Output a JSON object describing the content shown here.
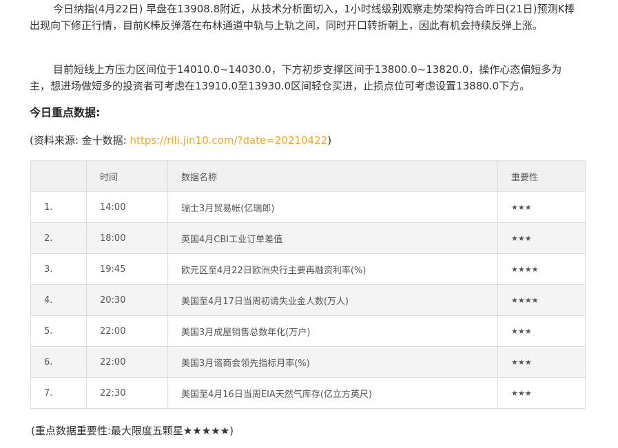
{
  "article": {
    "paragraph1": "今日纳指(4月22日) 早盘在13908.8附近，从技术分析面切入，1小时线级别观察走势架构符合昨日(21日)预测K棒出现向下修正行情，目前K棒反弹落在布林通道中轨与上轨之间，同时开口转折朝上，因此有机会持续反弹上涨。",
    "paragraph2": "目前短线上方压力区间位于14010.0~14030.0，下方初步支撑区间于13800.0~13820.0，操作心态偏短多为主，想进场做短多的投资者可考虑在13910.0至13930.0区间轻仓买进，止损点位可考虑设置13880.0下方。",
    "section_title": "今日重点数据:",
    "source_prefix": "(资料来源: 金十数据: ",
    "source_link": "https://rili.jin10.com/?date=20210422",
    "source_suffix": ")",
    "note": "(重点数据重要性:最大限度五颗星★★★★★)"
  },
  "table": {
    "headers": [
      "",
      "时间",
      "数据名称",
      "重要性"
    ],
    "rows": [
      {
        "no": "1.",
        "time": "14:00",
        "name": "瑞士3月贸易帐(亿瑞郎)",
        "importance": "★★★"
      },
      {
        "no": "2.",
        "time": "18:00",
        "name": "英国4月CBI工业订单差值",
        "importance": "★★★"
      },
      {
        "no": "3.",
        "time": "19:45",
        "name": "欧元区至4月22日欧洲央行主要再融资利率(%)",
        "importance": "★★★★"
      },
      {
        "no": "4.",
        "time": "20:30",
        "name": "美国至4月17日当周初请失业金人数(万人)",
        "importance": "★★★★"
      },
      {
        "no": "5.",
        "time": "22:00",
        "name": "美国3月成屋销售总数年化(万户)",
        "importance": "★★★"
      },
      {
        "no": "6.",
        "time": "22:00",
        "name": "美国3月谘商会领先指标月率(%)",
        "importance": "★★★"
      },
      {
        "no": "7.",
        "time": "22:30",
        "name": "美国至4月16日当周EIA天然气库存(亿立方英尺)",
        "importance": "★★★"
      }
    ]
  }
}
